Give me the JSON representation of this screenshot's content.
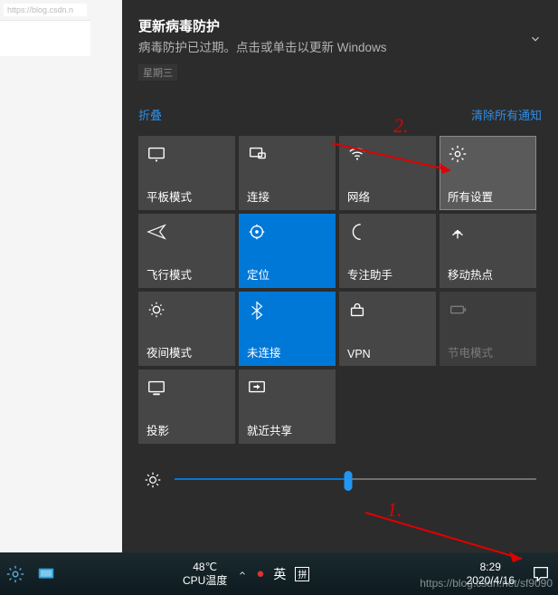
{
  "browser": {
    "url_fragment": "https://blog.csdn.n"
  },
  "notification": {
    "title": "更新病毒防护",
    "body": "病毒防护已过期。点击或单击以更新 Windows",
    "date": "星期三"
  },
  "links": {
    "collapse": "折叠",
    "clear_all": "清除所有通知"
  },
  "tiles": [
    {
      "id": "tablet-mode",
      "label": "平板模式",
      "icon": "tablet-icon",
      "state": "off"
    },
    {
      "id": "connect",
      "label": "连接",
      "icon": "connect-icon",
      "state": "off"
    },
    {
      "id": "network",
      "label": "网络",
      "icon": "wifi-icon",
      "state": "off"
    },
    {
      "id": "all-settings",
      "label": "所有设置",
      "icon": "gear-icon",
      "state": "hover"
    },
    {
      "id": "airplane-mode",
      "label": "飞行模式",
      "icon": "airplane-icon",
      "state": "off"
    },
    {
      "id": "location",
      "label": "定位",
      "icon": "location-icon",
      "state": "on"
    },
    {
      "id": "focus-assist",
      "label": "专注助手",
      "icon": "moon-icon",
      "state": "off"
    },
    {
      "id": "hotspot",
      "label": "移动热点",
      "icon": "hotspot-icon",
      "state": "off"
    },
    {
      "id": "night-light",
      "label": "夜间模式",
      "icon": "nightlight-icon",
      "state": "off"
    },
    {
      "id": "bluetooth",
      "label": "未连接",
      "icon": "bluetooth-icon",
      "state": "on"
    },
    {
      "id": "vpn",
      "label": "VPN",
      "icon": "vpn-icon",
      "state": "off"
    },
    {
      "id": "battery-saver",
      "label": "节电模式",
      "icon": "battery-icon",
      "state": "disabled"
    },
    {
      "id": "project",
      "label": "投影",
      "icon": "project-icon",
      "state": "off"
    },
    {
      "id": "nearby-share",
      "label": "就近共享",
      "icon": "share-icon",
      "state": "off"
    }
  ],
  "brightness": {
    "percent": 48
  },
  "taskbar": {
    "temp_value": "48℃",
    "temp_label": "CPU温度",
    "ime_indicator_circle": "㊥",
    "ime_lang": "英",
    "ime_mode": "⊞",
    "time": "8:29",
    "date": "2020/4/16"
  },
  "annotations": {
    "one": "1.",
    "two": "2."
  },
  "watermark": "https://blog.csdn.net/sf9090"
}
